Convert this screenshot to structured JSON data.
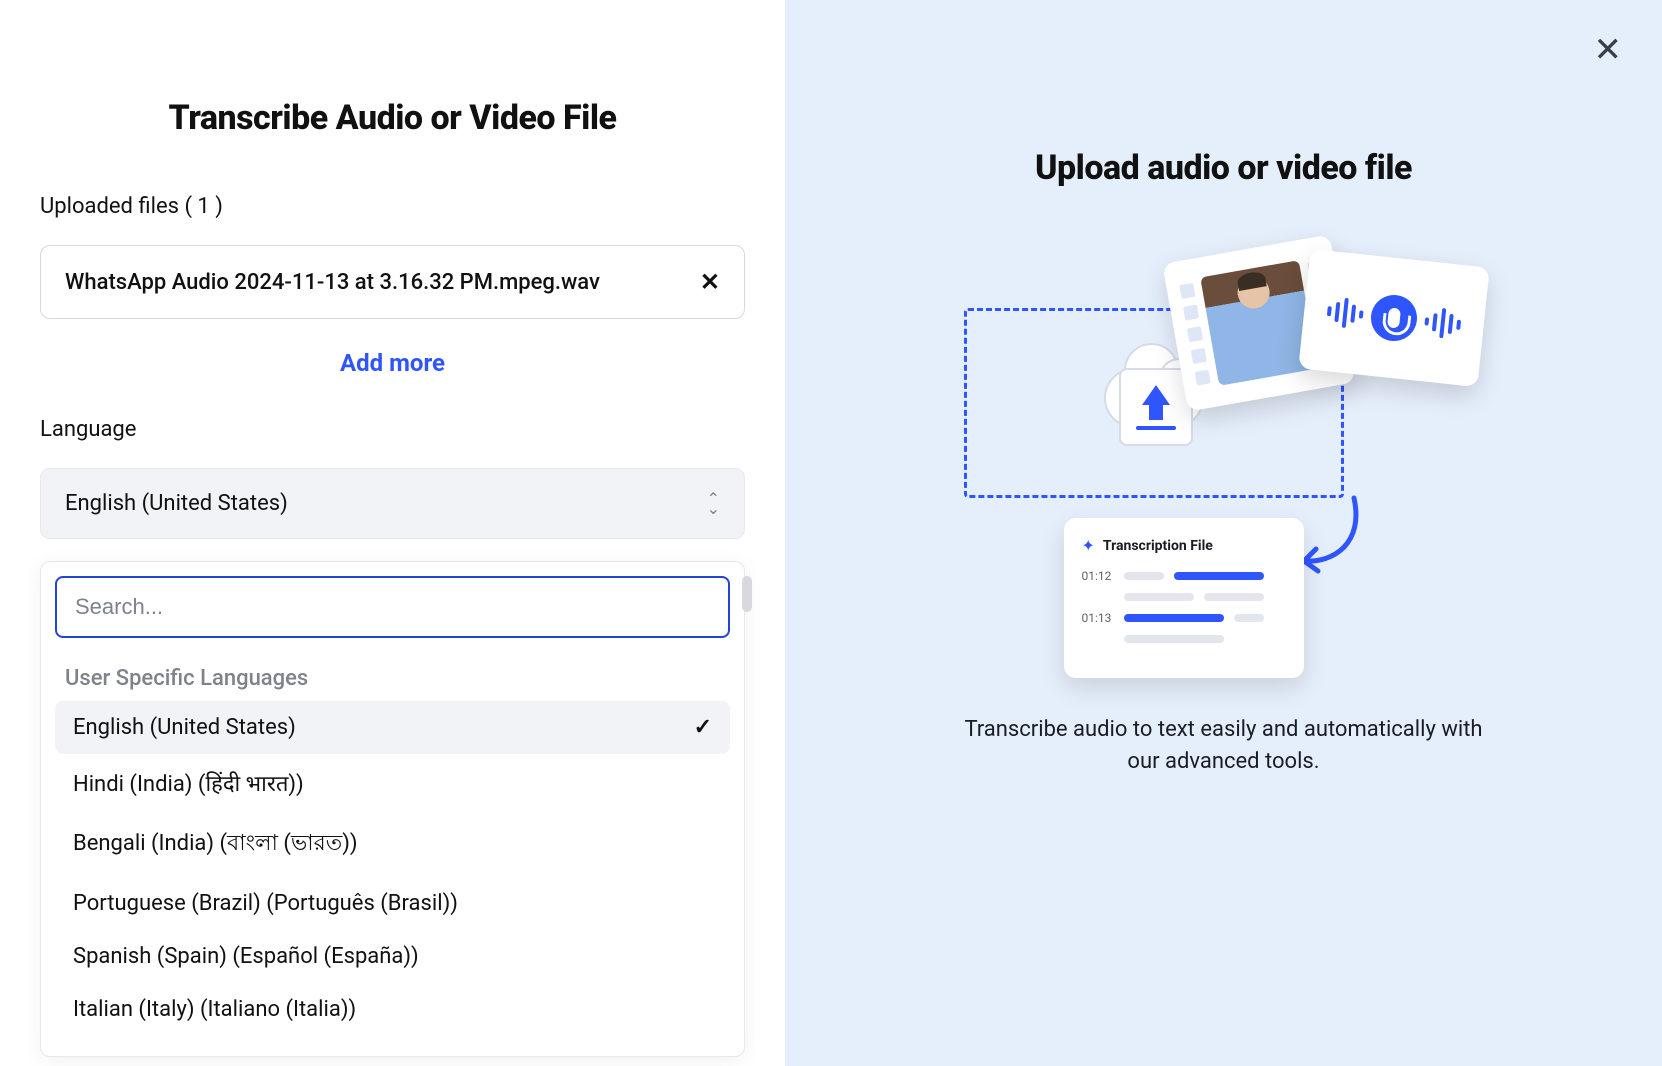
{
  "left": {
    "title": "Transcribe Audio or Video File",
    "uploaded_label": "Uploaded files ( 1 )",
    "file_name": "WhatsApp Audio 2024-11-13 at 3.16.32 PM.mpeg.wav",
    "add_more": "Add more",
    "language_label": "Language",
    "selected_language": "English (United States)",
    "search_placeholder": "Search...",
    "group_header": "User Specific Languages",
    "options": [
      {
        "label": "English (United States)",
        "selected": true
      },
      {
        "label": "Hindi (India) (हिंदी भारत))",
        "selected": false
      },
      {
        "label": "Bengali (India) (বাংলা (ভারত))",
        "selected": false
      },
      {
        "label": "Portuguese (Brazil) (Português (Brasil))",
        "selected": false
      },
      {
        "label": "Spanish (Spain) (Español (España))",
        "selected": false
      },
      {
        "label": "Italian (Italy) (Italiano (Italia))",
        "selected": false
      }
    ]
  },
  "right": {
    "title": "Upload audio or video file",
    "transcription_card_title": "Transcription File",
    "ts1": "01:12",
    "ts2": "01:13",
    "description": "Transcribe audio to text easily and automatically with our advanced tools."
  }
}
